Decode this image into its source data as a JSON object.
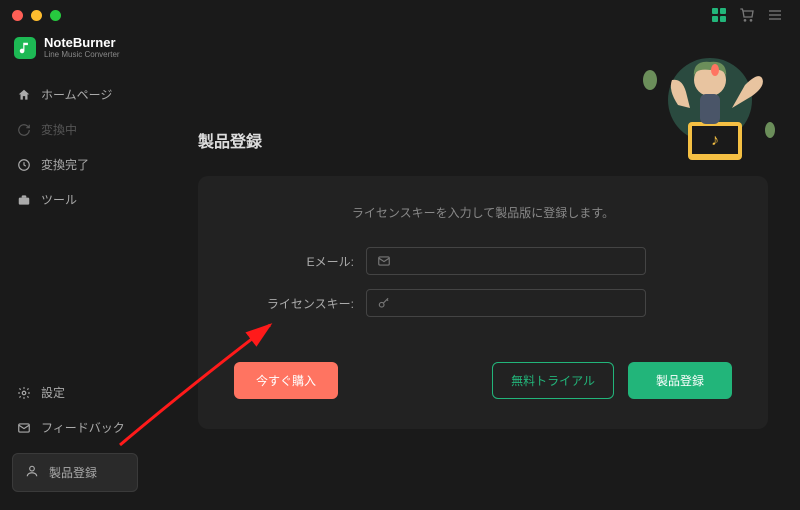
{
  "brand": {
    "name": "NoteBurner",
    "sub": "Line Music Converter"
  },
  "sidebar": {
    "items": [
      {
        "label": "ホームページ",
        "icon": "home"
      },
      {
        "label": "変換中",
        "icon": "refresh",
        "dim": true
      },
      {
        "label": "変換完了",
        "icon": "clock"
      },
      {
        "label": "ツール",
        "icon": "toolbox"
      }
    ],
    "bottom": [
      {
        "label": "設定",
        "icon": "gear"
      },
      {
        "label": "フィードバック",
        "icon": "mail"
      }
    ],
    "register": "製品登録"
  },
  "page": {
    "title": "製品登録",
    "description": "ライセンスキーを入力して製品版に登録します。",
    "fields": {
      "email_label": "Eメール:",
      "license_label": "ライセンスキー:"
    },
    "buttons": {
      "buy": "今すぐ購入",
      "trial": "無料トライアル",
      "register": "製品登録"
    }
  },
  "colors": {
    "accent": "#22b57a",
    "danger": "#ff7461",
    "bg": "#1a1a1a",
    "panel": "#222"
  }
}
